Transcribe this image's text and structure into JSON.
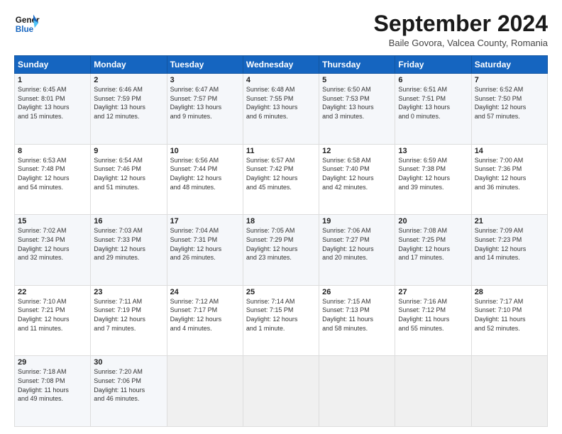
{
  "header": {
    "logo_line1": "General",
    "logo_line2": "Blue",
    "month_title": "September 2024",
    "subtitle": "Baile Govora, Valcea County, Romania"
  },
  "days_of_week": [
    "Sunday",
    "Monday",
    "Tuesday",
    "Wednesday",
    "Thursday",
    "Friday",
    "Saturday"
  ],
  "weeks": [
    [
      {
        "day": "1",
        "info": "Sunrise: 6:45 AM\nSunset: 8:01 PM\nDaylight: 13 hours\nand 15 minutes."
      },
      {
        "day": "2",
        "info": "Sunrise: 6:46 AM\nSunset: 7:59 PM\nDaylight: 13 hours\nand 12 minutes."
      },
      {
        "day": "3",
        "info": "Sunrise: 6:47 AM\nSunset: 7:57 PM\nDaylight: 13 hours\nand 9 minutes."
      },
      {
        "day": "4",
        "info": "Sunrise: 6:48 AM\nSunset: 7:55 PM\nDaylight: 13 hours\nand 6 minutes."
      },
      {
        "day": "5",
        "info": "Sunrise: 6:50 AM\nSunset: 7:53 PM\nDaylight: 13 hours\nand 3 minutes."
      },
      {
        "day": "6",
        "info": "Sunrise: 6:51 AM\nSunset: 7:51 PM\nDaylight: 13 hours\nand 0 minutes."
      },
      {
        "day": "7",
        "info": "Sunrise: 6:52 AM\nSunset: 7:50 PM\nDaylight: 12 hours\nand 57 minutes."
      }
    ],
    [
      {
        "day": "8",
        "info": "Sunrise: 6:53 AM\nSunset: 7:48 PM\nDaylight: 12 hours\nand 54 minutes."
      },
      {
        "day": "9",
        "info": "Sunrise: 6:54 AM\nSunset: 7:46 PM\nDaylight: 12 hours\nand 51 minutes."
      },
      {
        "day": "10",
        "info": "Sunrise: 6:56 AM\nSunset: 7:44 PM\nDaylight: 12 hours\nand 48 minutes."
      },
      {
        "day": "11",
        "info": "Sunrise: 6:57 AM\nSunset: 7:42 PM\nDaylight: 12 hours\nand 45 minutes."
      },
      {
        "day": "12",
        "info": "Sunrise: 6:58 AM\nSunset: 7:40 PM\nDaylight: 12 hours\nand 42 minutes."
      },
      {
        "day": "13",
        "info": "Sunrise: 6:59 AM\nSunset: 7:38 PM\nDaylight: 12 hours\nand 39 minutes."
      },
      {
        "day": "14",
        "info": "Sunrise: 7:00 AM\nSunset: 7:36 PM\nDaylight: 12 hours\nand 36 minutes."
      }
    ],
    [
      {
        "day": "15",
        "info": "Sunrise: 7:02 AM\nSunset: 7:34 PM\nDaylight: 12 hours\nand 32 minutes."
      },
      {
        "day": "16",
        "info": "Sunrise: 7:03 AM\nSunset: 7:33 PM\nDaylight: 12 hours\nand 29 minutes."
      },
      {
        "day": "17",
        "info": "Sunrise: 7:04 AM\nSunset: 7:31 PM\nDaylight: 12 hours\nand 26 minutes."
      },
      {
        "day": "18",
        "info": "Sunrise: 7:05 AM\nSunset: 7:29 PM\nDaylight: 12 hours\nand 23 minutes."
      },
      {
        "day": "19",
        "info": "Sunrise: 7:06 AM\nSunset: 7:27 PM\nDaylight: 12 hours\nand 20 minutes."
      },
      {
        "day": "20",
        "info": "Sunrise: 7:08 AM\nSunset: 7:25 PM\nDaylight: 12 hours\nand 17 minutes."
      },
      {
        "day": "21",
        "info": "Sunrise: 7:09 AM\nSunset: 7:23 PM\nDaylight: 12 hours\nand 14 minutes."
      }
    ],
    [
      {
        "day": "22",
        "info": "Sunrise: 7:10 AM\nSunset: 7:21 PM\nDaylight: 12 hours\nand 11 minutes."
      },
      {
        "day": "23",
        "info": "Sunrise: 7:11 AM\nSunset: 7:19 PM\nDaylight: 12 hours\nand 7 minutes."
      },
      {
        "day": "24",
        "info": "Sunrise: 7:12 AM\nSunset: 7:17 PM\nDaylight: 12 hours\nand 4 minutes."
      },
      {
        "day": "25",
        "info": "Sunrise: 7:14 AM\nSunset: 7:15 PM\nDaylight: 12 hours\nand 1 minute."
      },
      {
        "day": "26",
        "info": "Sunrise: 7:15 AM\nSunset: 7:13 PM\nDaylight: 11 hours\nand 58 minutes."
      },
      {
        "day": "27",
        "info": "Sunrise: 7:16 AM\nSunset: 7:12 PM\nDaylight: 11 hours\nand 55 minutes."
      },
      {
        "day": "28",
        "info": "Sunrise: 7:17 AM\nSunset: 7:10 PM\nDaylight: 11 hours\nand 52 minutes."
      }
    ],
    [
      {
        "day": "29",
        "info": "Sunrise: 7:18 AM\nSunset: 7:08 PM\nDaylight: 11 hours\nand 49 minutes."
      },
      {
        "day": "30",
        "info": "Sunrise: 7:20 AM\nSunset: 7:06 PM\nDaylight: 11 hours\nand 46 minutes."
      },
      {
        "day": "",
        "info": ""
      },
      {
        "day": "",
        "info": ""
      },
      {
        "day": "",
        "info": ""
      },
      {
        "day": "",
        "info": ""
      },
      {
        "day": "",
        "info": ""
      }
    ]
  ]
}
